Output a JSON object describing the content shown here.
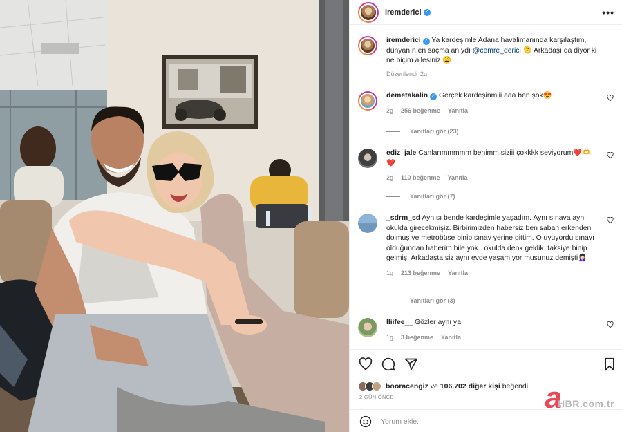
{
  "post": {
    "username": "iremderici",
    "caption_mention": "@cemre_derici",
    "caption_before": "Ya kardeşimle Adana havalimanında karşılaştım, dünyanın en saçma anıydı",
    "caption_after": "🫠 Arkadaşı da diyor ki ne biçim ailesiniz 😩",
    "edited_label": "Düzenlendi",
    "edited_time": "2g"
  },
  "comments": [
    {
      "user": "demetakalin",
      "verified": true,
      "text": "Gerçek kardeşinmiii aaa ben şok😍",
      "time": "2g",
      "likes": "256 beğenme",
      "reply": "Yanıtla",
      "view_replies": "Yanıtları gör (23)"
    },
    {
      "user": "ediz_jale",
      "text": "Canlarımmmmm benimm,siziii çokkkk seviyorum❤️🫶❤️",
      "time": "2g",
      "likes": "110 beğenme",
      "reply": "Yanıtla",
      "view_replies": "Yanıtları gör (7)"
    },
    {
      "user": "_sdrm_sd",
      "text": "Aynısı bende kardeşimle yaşadım. Aynı sınava aynı okulda girecekmişiz. Birbirimizden habersiz ben sabah erkenden dolmuş ve metrobüse binip sınav yerine gittim. O uyuyordu sınavı olduğundan haberim bile yok.. okulda denk geldik..taksiye binip gelmiş. Arkadaşta siz aynı evde yaşamıyor musunuz demişti🤦🏻‍♀️",
      "time": "1g",
      "likes": "213 beğenme",
      "reply": "Yanıtla",
      "view_replies": "Yanıtları gör (3)"
    },
    {
      "user": "lliifee__",
      "text": "Gözler aynı ya.",
      "time": "1g",
      "likes": "3 beğenme",
      "reply": "Yanıtla"
    }
  ],
  "actions": {
    "icons": [
      "heart-icon",
      "comment-icon",
      "share-icon",
      "bookmark-icon"
    ],
    "liked_by_user": "booracengiz",
    "liked_by_connector": "ve",
    "liked_by_others": "106.702 diğer kişi",
    "liked_by_suffix": "beğendi",
    "date": "2 GÜN ÖNCE",
    "comment_placeholder": "Yorum ekle...",
    "watermark_letter": "a",
    "watermark_text": "HBR.com.tr"
  },
  "colors": {
    "verified": "#3897f0",
    "muted": "#8e8e8e",
    "text": "#262626",
    "heart_red": "#ed4956"
  }
}
